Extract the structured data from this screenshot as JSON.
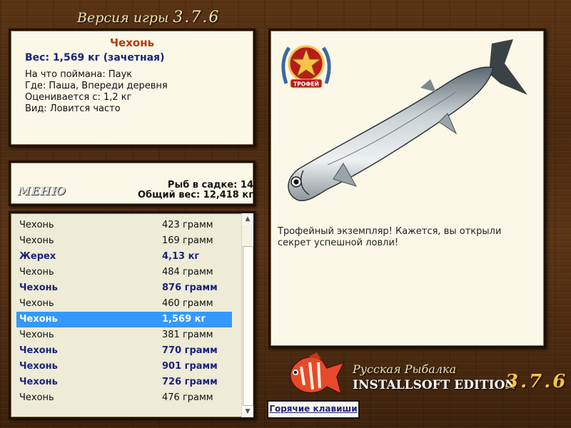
{
  "header": {
    "title": "Версия игры",
    "version": "3.7.6"
  },
  "catch_info": {
    "fish_name": "Чехонь",
    "weight": "Вес: 1,569 кг (зачетная)",
    "bait": "На что поймана: Паук",
    "place": "Где: Паша, Впереди деревня",
    "value": "Оценивается с: 1,2 кг",
    "kind": "Вид: Ловится часто"
  },
  "summary": {
    "menu_label": "МЕНЮ",
    "fish_count": "Рыб в садке: 14",
    "total_weight": "Общий вес: 12,418 кг"
  },
  "catch_list": [
    {
      "name": "Чехонь",
      "weight": "423 грамм",
      "bold": false,
      "selected": false
    },
    {
      "name": "Чехонь",
      "weight": "169 грамм",
      "bold": false,
      "selected": false
    },
    {
      "name": "Жерех",
      "weight": "4,13 кг",
      "bold": true,
      "selected": false
    },
    {
      "name": "Чехонь",
      "weight": "484 грамм",
      "bold": false,
      "selected": false
    },
    {
      "name": "Чехонь",
      "weight": "876 грамм",
      "bold": true,
      "selected": false
    },
    {
      "name": "Чехонь",
      "weight": "460 грамм",
      "bold": false,
      "selected": false
    },
    {
      "name": "Чехонь",
      "weight": "1,569 кг",
      "bold": true,
      "selected": true
    },
    {
      "name": "Чехонь",
      "weight": "381 грамм",
      "bold": false,
      "selected": false
    },
    {
      "name": "Чехонь",
      "weight": "770 грамм",
      "bold": true,
      "selected": false
    },
    {
      "name": "Чехонь",
      "weight": "901 грамм",
      "bold": true,
      "selected": false
    },
    {
      "name": "Чехонь",
      "weight": "726 грамм",
      "bold": true,
      "selected": false
    },
    {
      "name": "Чехонь",
      "weight": "476 грамм",
      "bold": false,
      "selected": false
    }
  ],
  "trophy_badge": "ТРОФЕЙ",
  "description": "Трофейный экземпляр! Кажется, вы открыли секрет успешной ловли!",
  "hotkeys_label": "Горячие клавиши",
  "brand": {
    "line1": "Русская Рыбалка",
    "line2": "INSTALLSOFT EDITION",
    "version": "3.7.6"
  },
  "colors": {
    "highlight": "#3399ff",
    "bold_text": "#1a237e",
    "fish_name": "#b33a00",
    "panel_bg": "#fbf8e8"
  }
}
